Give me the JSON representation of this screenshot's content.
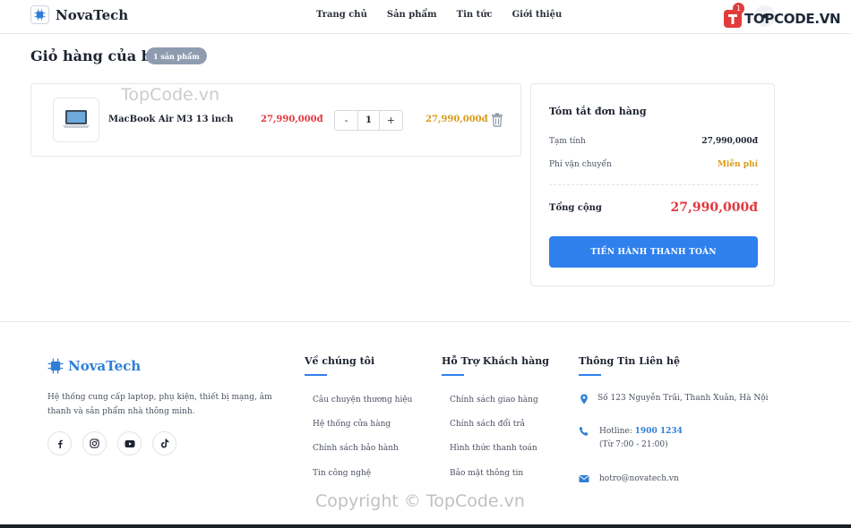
{
  "header": {
    "brand": "NovaTech",
    "nav": [
      "Trang chủ",
      "Sản phẩm",
      "Tin tức",
      "Giới thiệu"
    ],
    "cart_count": "1",
    "watermark_brand": "TOPCODE.VN"
  },
  "cart": {
    "title": "Giỏ hàng của bạn",
    "count_label": "1 sản phẩm",
    "items": [
      {
        "name": "MacBook Air M3 13 inch",
        "unit_price": "27,990,000đ",
        "qty": "1",
        "qty_minus": "-",
        "qty_plus": "+",
        "total": "27,990,000đ"
      }
    ]
  },
  "summary": {
    "title": "Tóm tắt đơn hàng",
    "subtotal_label": "Tạm tính",
    "subtotal_value": "27,990,000đ",
    "shipping_label": "Phí vận chuyển",
    "shipping_value": "Miễn phí",
    "total_label": "Tổng cộng",
    "total_value": "27,990,000đ",
    "checkout_label": "TIẾN HÀNH THANH TOÁN"
  },
  "footer": {
    "brand": "NovaTech",
    "description": "Hệ thống cung cấp laptop, phụ kiện, thiết bị mạng, âm thanh và sản phẩm nhà thông minh.",
    "about": {
      "title": "Về chúng tôi",
      "links": [
        "Câu chuyện thương hiệu",
        "Hệ thống cửa hàng",
        "Chính sách bảo hành",
        "Tin công nghệ"
      ]
    },
    "support": {
      "title": "Hỗ Trợ Khách hàng",
      "links": [
        "Chính sách giao hàng",
        "Chính sách đổi trả",
        "Hình thức thanh toán",
        "Bảo mật thông tin"
      ]
    },
    "contact": {
      "title": "Thông Tin Liên hệ",
      "address": "Số 123 Nguyễn Trãi, Thanh Xuân, Hà Nội",
      "hotline_label": "Hotline:",
      "hotline": "1900 1234",
      "hours": "(Từ 7:00 - 21:00)",
      "email": "hotro@novatech.vn"
    }
  },
  "watermarks": {
    "top": "TopCode.vn",
    "bottom": "Copyright © TopCode.vn"
  },
  "colors": {
    "accent": "#2f80ed",
    "price_red": "#e0383e",
    "price_gold": "#d99a1a"
  }
}
